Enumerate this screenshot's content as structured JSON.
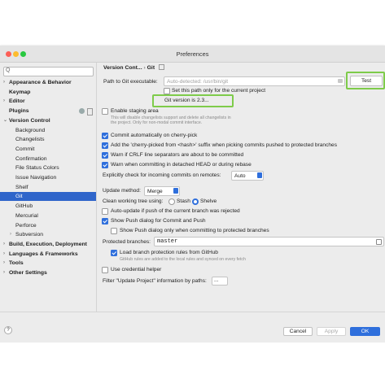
{
  "window": {
    "title": "Preferences"
  },
  "colors": {
    "accent": "#2f6fdc",
    "selection": "#2f65ca",
    "highlight": "#7ecb4a"
  },
  "sidebar": {
    "search_placeholder": "Q",
    "items": [
      {
        "label": "Appearance & Behavior",
        "arrow": "›",
        "bold": true
      },
      {
        "label": "Keymap",
        "arrow": "",
        "bold": true
      },
      {
        "label": "Editor",
        "arrow": "›",
        "bold": true
      },
      {
        "label": "Plugins",
        "arrow": "",
        "bold": true
      },
      {
        "label": "Version Control",
        "arrow": "⌄",
        "bold": true
      },
      {
        "label": "Background",
        "arrow": "",
        "sub": true
      },
      {
        "label": "Changelists",
        "arrow": "",
        "sub": true
      },
      {
        "label": "Commit",
        "arrow": "",
        "sub": true
      },
      {
        "label": "Confirmation",
        "arrow": "",
        "sub": true
      },
      {
        "label": "File Status Colors",
        "arrow": "",
        "sub": true
      },
      {
        "label": "Issue Navigation",
        "arrow": "",
        "sub": true
      },
      {
        "label": "Shelf",
        "arrow": "",
        "sub": true
      },
      {
        "label": "Git",
        "arrow": "",
        "sub": true,
        "selected": true
      },
      {
        "label": "GitHub",
        "arrow": "",
        "sub": true
      },
      {
        "label": "Mercurial",
        "arrow": "",
        "sub": true
      },
      {
        "label": "Perforce",
        "arrow": "",
        "sub": true
      },
      {
        "label": "Subversion",
        "arrow": "›",
        "sub": true
      },
      {
        "label": "Build, Execution, Deployment",
        "arrow": "›",
        "bold": true
      },
      {
        "label": "Languages & Frameworks",
        "arrow": "›",
        "bold": true
      },
      {
        "label": "Tools",
        "arrow": "›",
        "bold": true
      },
      {
        "label": "Other Settings",
        "arrow": "›",
        "bold": true
      }
    ]
  },
  "breadcrumb": {
    "parent": "Version Cont...",
    "sep": "›",
    "current": "Git"
  },
  "git": {
    "path_label": "Path to Git executable:",
    "path_placeholder": "Auto-detected: /usr/bin/git",
    "test_button": "Test",
    "set_path_label": "Set this path only for the current project",
    "version_popup": "Git version is 2.3...",
    "staging_label": "Enable staging area",
    "staging_hint_1": "This will disable changelists support and delete all changelists in",
    "staging_hint_2": "the project. Only for non-modal commit interface.",
    "commit_auto_label": "Commit automatically on cherry-pick",
    "cherry_suffix_label": "Add the 'cherry-picked from <hash>' suffix when picking commits pushed to protected branches",
    "crlf_label": "Warn if CRLF line separators are about to be committed",
    "detached_label": "Warn when committing in detached HEAD or during rebase",
    "incoming_label": "Explicitly check for incoming commits on remotes:",
    "incoming_value": "Auto",
    "update_method_label": "Update method:",
    "update_method_value": "Merge",
    "clean_tree_label": "Clean working tree using:",
    "stash_label": "Stash",
    "shelve_label": "Shelve",
    "auto_update_label": "Auto-update if push of the current branch was rejected",
    "show_push_label": "Show Push dialog for Commit and Push",
    "show_push_protected_label": "Show Push dialog only when committing to protected branches",
    "protected_label": "Protected branches:",
    "protected_value": "master",
    "load_protection_label": "Load branch protection rules from GitHub",
    "load_protection_hint": "GitHub rules are added to the local rules and synced on every fetch",
    "credential_label": "Use credential helper",
    "filter_label": "Filter \"Update Project\" information by paths:",
    "filter_value": "..."
  },
  "footer": {
    "help": "?",
    "cancel": "Cancel",
    "apply": "Apply",
    "ok": "OK"
  }
}
